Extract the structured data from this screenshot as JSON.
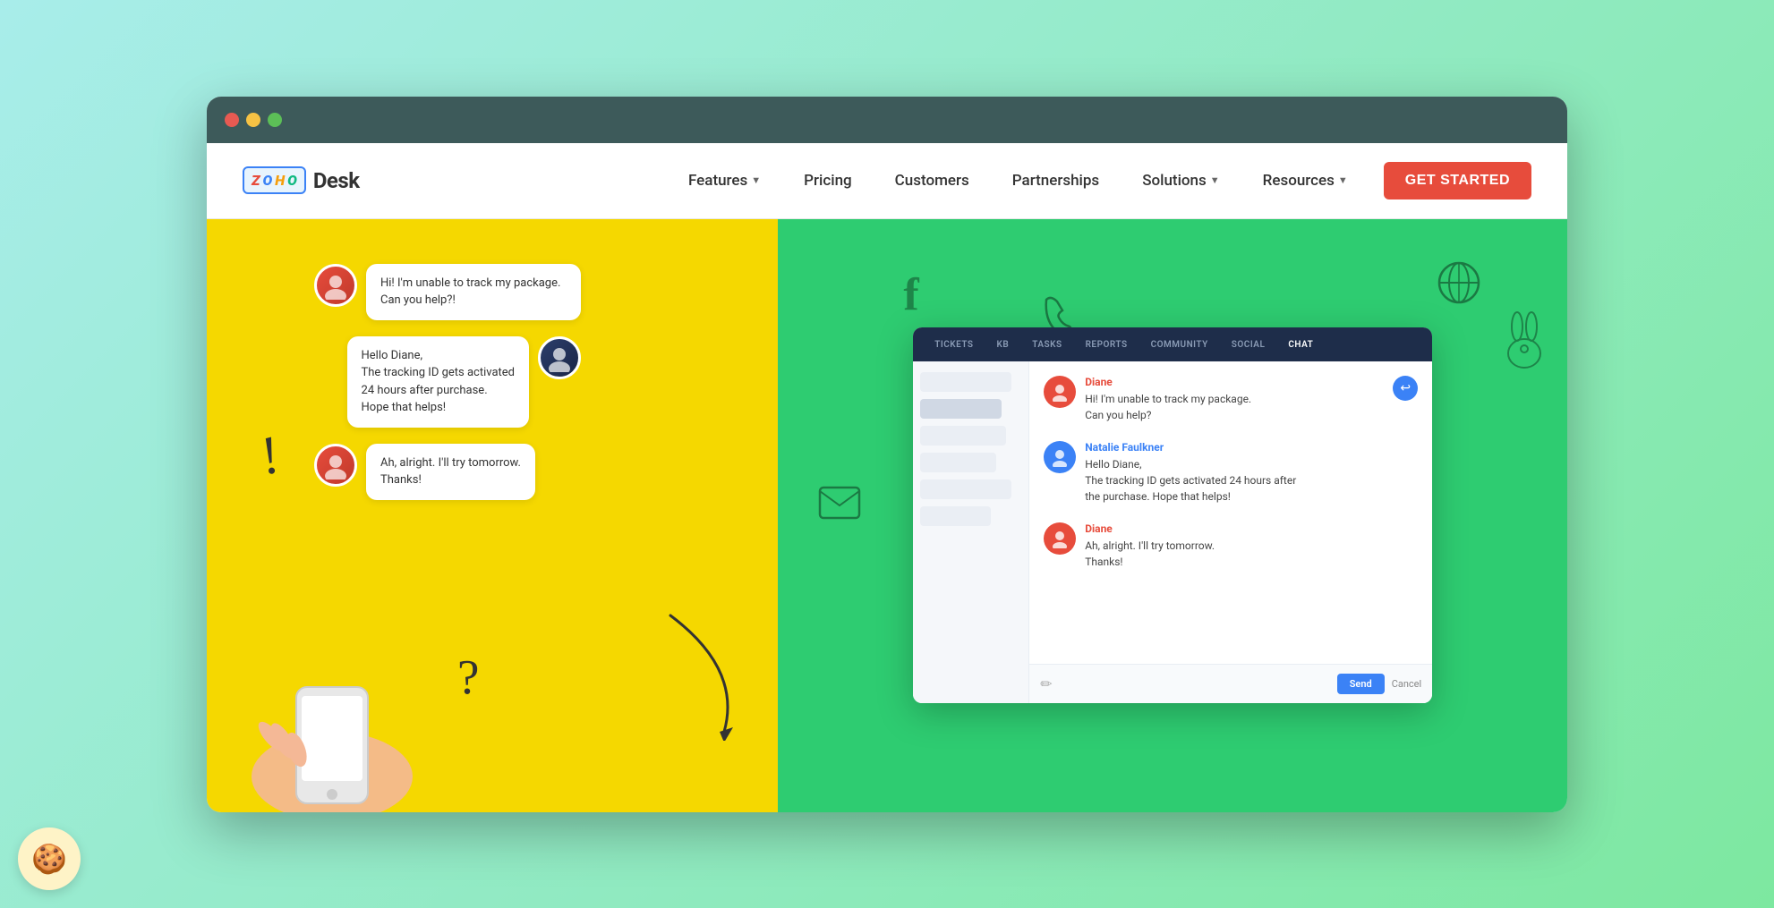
{
  "browser": {
    "dots": [
      "red",
      "yellow",
      "green"
    ]
  },
  "navbar": {
    "logo_zoho": "ZOHO",
    "logo_desk": "Desk",
    "nav_items": [
      {
        "label": "Features",
        "has_dropdown": true
      },
      {
        "label": "Pricing",
        "has_dropdown": false
      },
      {
        "label": "Customers",
        "has_dropdown": false
      },
      {
        "label": "Partnerships",
        "has_dropdown": false
      },
      {
        "label": "Solutions",
        "has_dropdown": true
      },
      {
        "label": "Resources",
        "has_dropdown": true
      }
    ],
    "cta": "GET STARTED"
  },
  "left_panel": {
    "bubble1_text": "Hi! I'm unable to track my package. Can you help?!",
    "bubble2_text": "Hello Diane,\nThe tracking ID gets activated\n24 hours after purchase.\nHope that helps!",
    "bubble3_text": "Ah, alright. I'll try tomorrow.\nThanks!"
  },
  "right_panel": {
    "desk_tabs": [
      "TICKETS",
      "KB",
      "TASKS",
      "REPORTS",
      "COMMUNITY",
      "SOCIAL",
      "CHAT"
    ],
    "active_tab": "CHAT",
    "chat": [
      {
        "name": "Diane",
        "name_color": "red",
        "text": "Hi! I'm unable to track my package.\nCan you help?"
      },
      {
        "name": "Natalie Faulkner",
        "name_color": "blue",
        "text": "Hello Diane,\nThe tracking ID gets activated 24 hours after\nthe purchase. Hope that helps!"
      },
      {
        "name": "Diane",
        "name_color": "red",
        "text": "Ah, alright. I'll try tomorrow.\nThanks!"
      }
    ],
    "reply_send": "Send",
    "reply_cancel": "Cancel"
  },
  "cookie": {
    "icon": "🍪"
  }
}
